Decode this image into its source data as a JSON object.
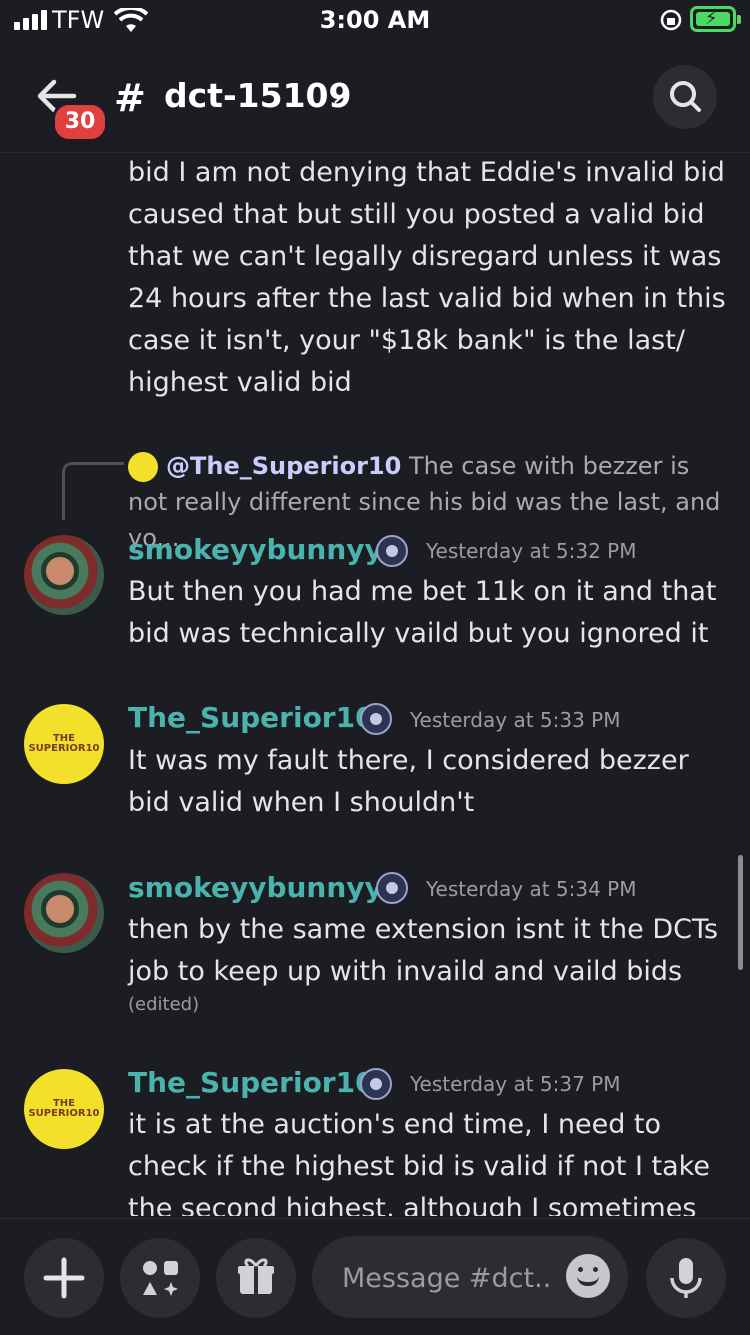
{
  "status_bar": {
    "carrier": "TFW",
    "time": "3:00 AM"
  },
  "header": {
    "back_count": "30",
    "channel_name": "dct-15109"
  },
  "messages": {
    "continued_text": "bid I am not denying that Eddie's invalid bid caused that but still you posted a valid bid that we can't legally disregard unless it was 24 hours after the last valid bid when in this case it isn't, your \"$18k bank\" is the last/ highest valid bid",
    "reply": {
      "mention": "@The_Superior10",
      "preview": "The case with bezzer is not really different since his bid was the last, and yo..."
    },
    "items": [
      {
        "author": "smokeyybunnyyy",
        "author_color": "#4ab3ae",
        "timestamp": "Yesterday at 5:32 PM",
        "text": "But then you had me bet 11k on it and that bid was technically vaild but you ignored it"
      },
      {
        "author": "The_Superior10",
        "author_color": "#4ab3ae",
        "timestamp": "Yesterday at 5:33 PM",
        "text": "It was my fault there, I considered bezzer bid valid when I shouldn't"
      },
      {
        "author": "smokeyybunnyyy",
        "author_color": "#4ab3ae",
        "timestamp": "Yesterday at 5:34 PM",
        "text": "then by the same extension isnt it the DCTs job to keep up with invaild and vaild bids",
        "edited": "(edited)"
      },
      {
        "author": "The_Superior10",
        "author_color": "#4ab3ae",
        "timestamp": "Yesterday at 5:37 PM",
        "text": "it is at the auction's end time, I need to check if the highest bid is valid if not I take the second highest, although I sometimes"
      }
    ],
    "avatar_logo_text": "THE SUPERIOR10"
  },
  "composer": {
    "placeholder": "Message #dct..."
  },
  "icons": {
    "signal": "signal-icon",
    "wifi": "wifi-icon",
    "battery": "battery-charging-icon",
    "back": "back-arrow-icon",
    "channel": "hash-icon",
    "search": "search-icon",
    "plus": "plus-icon",
    "apps": "apps-icon",
    "gift": "gift-icon",
    "emoji": "emoji-icon",
    "mic": "microphone-icon"
  }
}
